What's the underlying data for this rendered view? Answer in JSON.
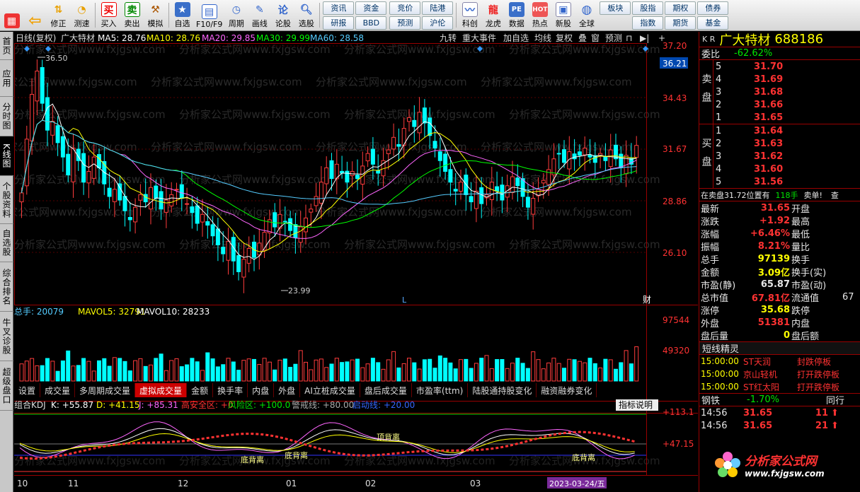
{
  "toolbar": {
    "nav": [
      {
        "label": ""
      },
      {
        "label": ""
      },
      {
        "label": "修正"
      },
      {
        "label": "测速"
      }
    ],
    "trade": [
      {
        "label": "买入"
      },
      {
        "label": "卖出"
      },
      {
        "label": "模拟"
      }
    ],
    "tools": [
      {
        "label": "自选"
      },
      {
        "label": "F10/F9"
      },
      {
        "label": "周期"
      },
      {
        "label": "画线"
      },
      {
        "label": "论股"
      },
      {
        "label": "选股"
      }
    ],
    "grid1": [
      "资讯",
      "资金",
      "研报",
      "BBD"
    ],
    "grid2": [
      "竞价",
      "陆港",
      "预测",
      "沪伦"
    ],
    "more": [
      {
        "label": "科创"
      },
      {
        "label": "龙虎"
      },
      {
        "label": "数据"
      },
      {
        "label": "热点"
      },
      {
        "label": "新股"
      },
      {
        "label": "全球"
      }
    ],
    "grid3": [
      "板块",
      "股指",
      "期权",
      "债券",
      "",
      "指数",
      "期货",
      "基金"
    ]
  },
  "sidetabs": [
    "首页",
    "应用",
    "分时图",
    "K线图",
    "个股资料",
    "自选股",
    "综合排名",
    "牛叉诊股",
    "超级盘口"
  ],
  "header": {
    "period": "日线(复权)",
    "stock": "广大特材",
    "ma5": "MA5: 28.76",
    "ma10": "MA10: 28.76",
    "ma20": "MA20: 29.85",
    "ma30": "MA30: 29.99",
    "ma60": "MA60: 28.58",
    "tools": [
      "九转",
      "重大事件",
      "加自选",
      "均线",
      "复权",
      "叠",
      "窗",
      "预测"
    ]
  },
  "price_axis": [
    "37.20",
    "36.21",
    "34.43",
    "31.67",
    "28.86",
    "26.10"
  ],
  "annotations": {
    "high": "36.50",
    "low": "23.99",
    "cai": "财",
    "l": "L"
  },
  "watermark": "分析家公式网www.fxjgsw.com",
  "volume": {
    "total": "总手: 20079",
    "mavol5": "MAVOL5: 32791",
    "mavol10": "MAVOL10: 28233",
    "axis": [
      "97544",
      "49320"
    ]
  },
  "tabs": [
    "设置",
    "成交量",
    "多周期成交量",
    "虚拟成交量",
    "金额",
    "换手率",
    "内盘",
    "外盘",
    "AI立桩成交量",
    "盘后成交量",
    "市盈率(ttm)",
    "陆股通持股变化",
    "融资融券变化"
  ],
  "kdj": {
    "name": "组合KDJ",
    "k": "K: +55.87",
    "d": "D: +41.15",
    "j": "J: +85.31",
    "high": "高安全区: +0",
    "risk": "风险区: +100.0",
    "alert": "警戒线: +80.00",
    "start": "启动线: +20.00",
    "help": "指标说明",
    "axis": [
      "+113.1",
      "+47.15"
    ],
    "labels": [
      "底背离",
      "底背离",
      "顶背离",
      "底背离"
    ]
  },
  "xaxis": [
    "10",
    "11",
    "12",
    "01",
    "02",
    "03"
  ],
  "date_tag": "2023-03-24/五",
  "quote": {
    "kr": "K R",
    "name": "广大特材",
    "code": "688186",
    "weibi_label": "委比",
    "weibi": "-62.62%",
    "sell_label": "卖盘",
    "buy_label": "买盘",
    "sells": [
      {
        "n": "5",
        "p": "31.70"
      },
      {
        "n": "4",
        "p": "31.69"
      },
      {
        "n": "3",
        "p": "31.68"
      },
      {
        "n": "2",
        "p": "31.66"
      },
      {
        "n": "1",
        "p": "31.65"
      }
    ],
    "buys": [
      {
        "n": "1",
        "p": "31.64"
      },
      {
        "n": "2",
        "p": "31.63"
      },
      {
        "n": "3",
        "p": "31.62"
      },
      {
        "n": "4",
        "p": "31.60"
      },
      {
        "n": "5",
        "p": "31.56"
      }
    ],
    "order_line": "在卖盘31.72位置有",
    "order_qty": "118手",
    "order_sell": "卖单!",
    "order_look": "查",
    "stats": [
      [
        "最新",
        "31.65",
        "开盘",
        ""
      ],
      [
        "涨跌",
        "+1.92",
        "最高",
        ""
      ],
      [
        "涨幅",
        "+6.46%",
        "最低",
        ""
      ],
      [
        "振幅",
        "8.21%",
        "量比",
        ""
      ],
      [
        "总手",
        "97139",
        "换手",
        ""
      ],
      [
        "金额",
        "3.09亿",
        "换手(实)",
        ""
      ],
      [
        "市盈(静)",
        "65.87",
        "市盈(动)",
        ""
      ],
      [
        "总市值",
        "67.81亿",
        "流通值",
        "67"
      ],
      [
        "涨停",
        "35.68",
        "跌停",
        ""
      ],
      [
        "外盘",
        "51381",
        "内盘",
        ""
      ],
      [
        "盘后量",
        "0",
        "盘后额",
        ""
      ]
    ],
    "short_title": "短线精灵",
    "short": [
      {
        "t": "15:00:00",
        "s": "ST天润",
        "e": "封跌停板"
      },
      {
        "t": "15:00:00",
        "s": "京山轻机",
        "e": "打开跌停板"
      },
      {
        "t": "15:00:00",
        "s": "ST红太阳",
        "e": "打开跌停板"
      }
    ],
    "sector": "钢铁",
    "sector_chg": "-1.70%",
    "sector_more": "同行",
    "ticks": [
      {
        "t": "14:56",
        "p": "31.65",
        "v": "11"
      },
      {
        "t": "14:56",
        "p": "31.65",
        "v": "21"
      }
    ],
    "logo": "分析家公式网",
    "logo_url": "www.fxjgsw.com"
  }
}
